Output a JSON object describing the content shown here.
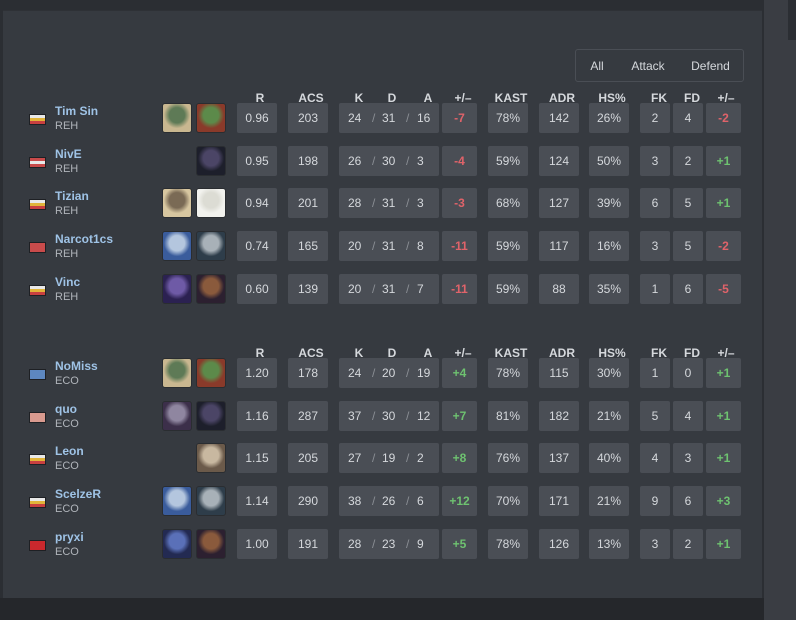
{
  "filters": [
    {
      "label": "All",
      "active": true
    },
    {
      "label": "Attack",
      "active": false
    },
    {
      "label": "Defend",
      "active": false
    }
  ],
  "columns": [
    "R",
    "ACS",
    "K",
    "D",
    "A",
    "+/–",
    "KAST",
    "ADR",
    "HS%",
    "FK",
    "FD",
    "+/–"
  ],
  "kda_separator": "/",
  "teams": [
    {
      "players": [
        {
          "name": "Tim Sin",
          "team": "REH",
          "flag": "flag-de",
          "agents": [
            "skye-icon",
            "skye-alt-icon"
          ],
          "r": "0.96",
          "acs": "203",
          "k": "24",
          "d": "31",
          "a": "16",
          "kd_diff": "-7",
          "kast": "78%",
          "adr": "142",
          "hs": "26%",
          "fk": "2",
          "fd": "4",
          "fk_diff": "-2"
        },
        {
          "name": "NivE",
          "team": "REH",
          "flag": "flag-at",
          "agents": [
            "omen-icon"
          ],
          "r": "0.95",
          "acs": "198",
          "k": "26",
          "d": "30",
          "a": "3",
          "kd_diff": "-4",
          "kast": "59%",
          "adr": "124",
          "hs": "50%",
          "fk": "3",
          "fd": "2",
          "fk_diff": "+1"
        },
        {
          "name": "Tizian",
          "team": "REH",
          "flag": "flag-de",
          "agents": [
            "sova-icon",
            "sage-icon"
          ],
          "r": "0.94",
          "acs": "201",
          "k": "28",
          "d": "31",
          "a": "3",
          "kd_diff": "-3",
          "kast": "68%",
          "adr": "127",
          "hs": "39%",
          "fk": "6",
          "fd": "5",
          "fk_diff": "+1"
        },
        {
          "name": "Narcot1cs",
          "team": "REH",
          "flag": "flag-tr",
          "agents": [
            "jett-icon",
            "killjoy-icon"
          ],
          "r": "0.74",
          "acs": "165",
          "k": "20",
          "d": "31",
          "a": "8",
          "kd_diff": "-11",
          "kast": "59%",
          "adr": "117",
          "hs": "16%",
          "fk": "3",
          "fd": "5",
          "fk_diff": "-2"
        },
        {
          "name": "Vinc",
          "team": "REH",
          "flag": "flag-de",
          "agents": [
            "reyna-icon",
            "astra-icon"
          ],
          "r": "0.60",
          "acs": "139",
          "k": "20",
          "d": "31",
          "a": "7",
          "kd_diff": "-11",
          "kast": "59%",
          "adr": "88",
          "hs": "35%",
          "fk": "1",
          "fd": "6",
          "fk_diff": "-5"
        }
      ]
    },
    {
      "players": [
        {
          "name": "NoMiss",
          "team": "ECO",
          "flag": "flag-un",
          "agents": [
            "skye-icon",
            "skye-alt-icon"
          ],
          "r": "1.20",
          "acs": "178",
          "k": "24",
          "d": "20",
          "a": "19",
          "kd_diff": "+4",
          "kast": "78%",
          "adr": "115",
          "hs": "30%",
          "fk": "1",
          "fd": "0",
          "fk_diff": "+1"
        },
        {
          "name": "quo",
          "team": "ECO",
          "flag": "flag-pl",
          "agents": [
            "viper-icon",
            "omen-icon"
          ],
          "r": "1.16",
          "acs": "287",
          "k": "37",
          "d": "30",
          "a": "12",
          "kd_diff": "+7",
          "kast": "81%",
          "adr": "182",
          "hs": "21%",
          "fk": "5",
          "fd": "4",
          "fk_diff": "+1"
        },
        {
          "name": "Leon",
          "team": "ECO",
          "flag": "flag-de",
          "agents": [
            "chamber-icon"
          ],
          "r": "1.15",
          "acs": "205",
          "k": "27",
          "d": "19",
          "a": "2",
          "kd_diff": "+8",
          "kast": "76%",
          "adr": "137",
          "hs": "40%",
          "fk": "4",
          "fd": "3",
          "fk_diff": "+1"
        },
        {
          "name": "ScelzeR",
          "team": "ECO",
          "flag": "flag-de",
          "agents": [
            "jett-icon",
            "killjoy-icon"
          ],
          "r": "1.14",
          "acs": "290",
          "k": "38",
          "d": "26",
          "a": "6",
          "kd_diff": "+12",
          "kast": "70%",
          "adr": "171",
          "hs": "21%",
          "fk": "9",
          "fd": "6",
          "fk_diff": "+3"
        },
        {
          "name": "pryxi",
          "team": "ECO",
          "flag": "flag-ch",
          "agents": [
            "astra-alt-icon",
            "astra-icon"
          ],
          "r": "1.00",
          "acs": "191",
          "k": "28",
          "d": "23",
          "a": "9",
          "kd_diff": "+5",
          "kast": "78%",
          "adr": "126",
          "hs": "13%",
          "fk": "3",
          "fd": "2",
          "fk_diff": "+1"
        }
      ]
    }
  ]
}
